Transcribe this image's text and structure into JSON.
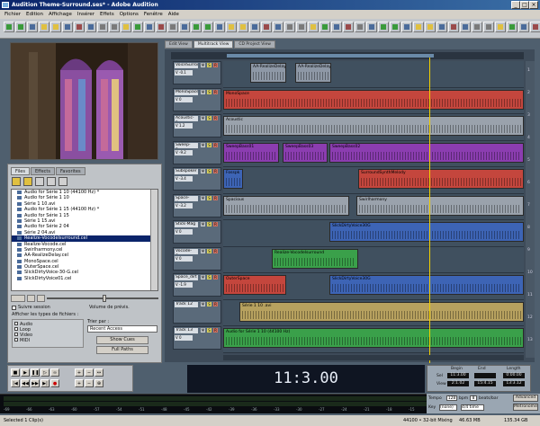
{
  "title": "Audition Theme-Surround.ses* - Adobe Audition",
  "menu": [
    "Fichier",
    "Edition",
    "Affichage",
    "Insérer",
    "Effets",
    "Options",
    "Fenêtre",
    "Aide"
  ],
  "view_tabs": [
    "Edit View",
    "Multitrack View",
    "CD Project View"
  ],
  "panel_tabs": [
    "Files",
    "Effects",
    "Favorites"
  ],
  "files": [
    "Audio for Série 1 10 (44100 Hz) *",
    "Audio for Série 1 10",
    "Série 1 10.avi",
    "Audio for Série 1 15 (44100 Hz) *",
    "Audio for Série 1 15",
    "Série 1 15.avi",
    "Audio for Série 2 04",
    "Série 2 04.avi",
    "Realize-Vocodelsurround.cel",
    "Realize-Vocode.cel",
    "Swirlharmony.cel",
    "AA-RealizeDelay.cel",
    "MonoSpace.cel",
    "OuterSpace.cel",
    "SlickDirtyVoice-30-G.cel",
    "SlickDirtyVoice01.cel"
  ],
  "selected_file_index": 8,
  "follow_session_label": "Suivre session",
  "preview_volume_label": "Volume de prévis.",
  "show_types_label": "Afficher les types de fichiers :",
  "types": [
    "Audio",
    "Loop",
    "Video",
    "MIDI"
  ],
  "sort_label": "Trier par :",
  "sort_value": "Recent Access",
  "btn_show_cues": "Show Cues",
  "btn_full_paths": "Full Paths",
  "tracks": [
    {
      "name": "VoiceSurroundPl",
      "vol": "V -0.1",
      "clips": [
        {
          "label": "AA-RealizeDelay",
          "color": "#8e98a6"
        },
        {
          "label": "AA-RealizeDelay",
          "color": "#8e98a6"
        }
      ]
    },
    {
      "name": "MonoSpace",
      "vol": "V 0",
      "clips": [
        {
          "label": "MonoSpace",
          "color": "#c4463d"
        }
      ]
    },
    {
      "name": "Acoustic-Pan",
      "vol": "V 1.2",
      "clips": [
        {
          "label": "Acoustic",
          "color": "#9aa2ac"
        }
      ]
    },
    {
      "name": "Sweep-Bass",
      "vol": "V -9.2",
      "clips": [
        {
          "label": "SweepBass01",
          "color": "#8b3db0"
        },
        {
          "label": "SweepBass03",
          "color": "#8b3db0"
        },
        {
          "label": "SweepBass02",
          "color": "#8b3db0"
        }
      ]
    },
    {
      "name": "Subspoker",
      "vol": "V -3.4",
      "clips": [
        {
          "label": "Fosspk",
          "color": "#3d64b5"
        },
        {
          "label": "SurroundSynthMelody",
          "color": "#c4463d"
        }
      ]
    },
    {
      "name": "Space-Harm",
      "vol": "V -3.2",
      "clips": [
        {
          "label": "Spacious",
          "color": "#9aa2ac"
        },
        {
          "label": "Swirlharmony",
          "color": "#9aa2ac"
        }
      ]
    },
    {
      "name": "Stick-Mag",
      "vol": "V 0",
      "clips": [
        {
          "label": "SlickDirtyVoice30G",
          "color": "#3d64b5"
        }
      ]
    },
    {
      "name": "Vocode-Surr",
      "vol": "V 0",
      "clips": [
        {
          "label": "Realize-Vocodelsurround",
          "color": "#3aa04a"
        }
      ]
    },
    {
      "name": "Space_dirt",
      "vol": "V -1.9",
      "clips": [
        {
          "label": "OuterSpace",
          "color": "#c4463d"
        },
        {
          "label": "SlickDirtyVoice30G",
          "color": "#3d64b5"
        }
      ]
    },
    {
      "name": "Track 12",
      "vol": "",
      "clips": [
        {
          "label": "Série 1 10 .avi",
          "color": "#b7a15f"
        }
      ]
    },
    {
      "name": "Track 13",
      "vol": "V 0",
      "clips": [
        {
          "label": "Audio for Série 1 10 (44100 Hz)",
          "color": "#3aa04a"
        }
      ]
    }
  ],
  "track_numbers": [
    "1",
    "2",
    "3",
    "4",
    "5",
    "6",
    "7",
    "8",
    "9",
    "10",
    "11",
    "12",
    "13"
  ],
  "time_display": "11:3.00",
  "info": {
    "begin_label": "Begin",
    "end_label": "End",
    "length_label": "Length",
    "sel_label": "Sel",
    "view_label": "View",
    "sel_begin": "11:3.00",
    "sel_end": "",
    "sel_length": "0:00.00",
    "view_begin": "2:1.02",
    "view_end": "15:4.15",
    "view_length": "13:3.12"
  },
  "tempo_label": "Tempo",
  "tempo_value": "128",
  "bpm_label": "bpm",
  "beats_label": "8",
  "beats_bar_label": "beats/bar",
  "key_label": "Key",
  "key_value": "(none)",
  "time_sig": "4/4 time",
  "advanced_label": "Advanced",
  "metronome_label": "Metronome",
  "meter_ticks": [
    "-69",
    "-66",
    "-63",
    "-60",
    "-57",
    "-54",
    "-51",
    "-48",
    "-45",
    "-42",
    "-39",
    "-36",
    "-33",
    "-30",
    "-27",
    "-24",
    "-21",
    "-18",
    "-15",
    "-12",
    "-9",
    "-6",
    "-3",
    "0"
  ],
  "status_left": "Selected 1 Clip(s)",
  "status_rate": "44100 • 32-bit Mixing",
  "status_mem": "46.63 MB",
  "status_disk": "135.34 GB",
  "colors": {
    "title_bar": "#0a246a",
    "playhead": "#f2d000",
    "time_bg": "#0f1522"
  }
}
